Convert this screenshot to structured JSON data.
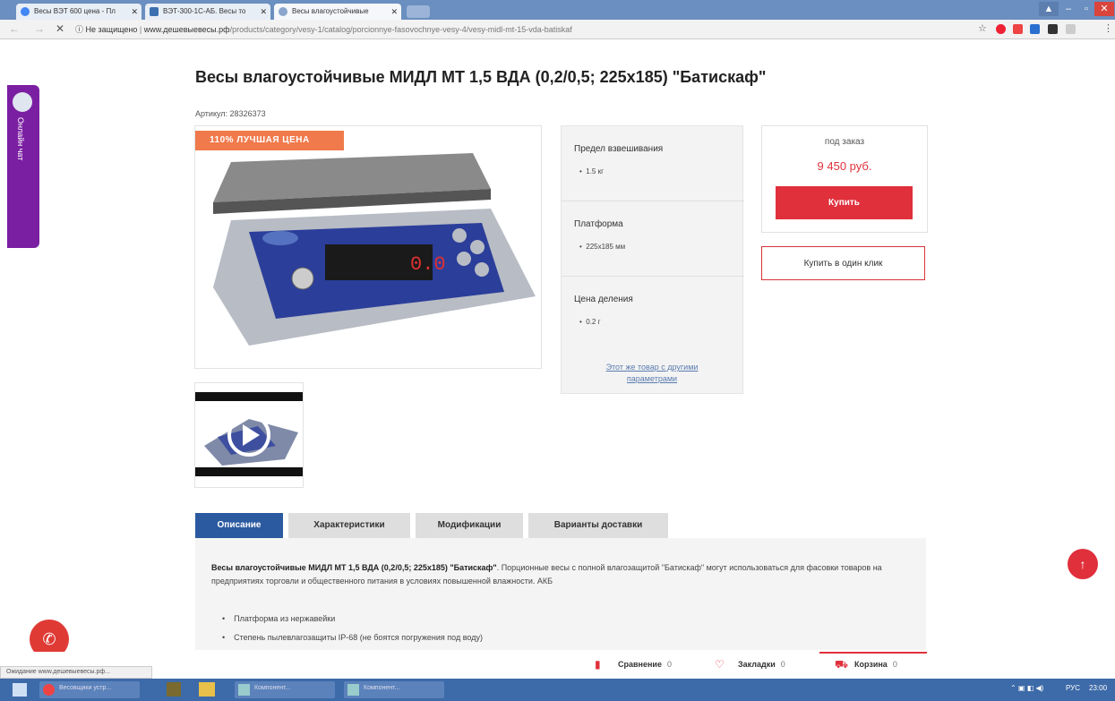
{
  "browser": {
    "tabs": [
      {
        "label": "Весы ВЭТ 600 цена - Пл",
        "color": "#4285f4"
      },
      {
        "label": "ВЭТ-300-1С-АБ. Весы то",
        "color": "#3a6fb0"
      },
      {
        "label": "Весы влагоустойчивые",
        "color": "#8aa6cc"
      }
    ],
    "security_label": "Не защищено",
    "url_host": "www.дешевыевесы.рф",
    "url_path": "/products/category/vesy-1/catalog/porcionnye-fasovochnye-vesy-4/vesy-midl-mt-15-vda-batiskaf",
    "status_text": "Ожидание www.дешевыевесы.рф..."
  },
  "side_chat": {
    "label": "Онлайн чат"
  },
  "product": {
    "title": "Весы влагоустойчивые МИДЛ МТ 1,5 ВДА (0,2/0,5; 225х185) \"Батискаф\"",
    "sku": "Артикул: 28326373",
    "badge": "110% ЛУЧШАЯ ЦЕНА",
    "scale_display": "0.0",
    "specs": [
      {
        "title": "Предел взвешивания",
        "value": "1.5 кг"
      },
      {
        "title": "Платформа",
        "value": "225х185 мм"
      },
      {
        "title": "Цена деления",
        "value": "0.2 г"
      }
    ],
    "other_params_link_1": "Этот же товар с другими",
    "other_params_link_2": "параметрами",
    "availability": "под заказ",
    "price": "9 450 руб.",
    "buy_label": "Купить",
    "one_click_label": "Купить в один клик"
  },
  "tabs": [
    {
      "label": "Описание"
    },
    {
      "label": "Характеристики"
    },
    {
      "label": "Модификации"
    },
    {
      "label": "Варианты доставки"
    }
  ],
  "description": {
    "bold": "Весы влагоустойчивые МИДЛ МТ 1,5 ВДА (0,2/0,5; 225х185) \"Батискаф\"",
    "text": ". Порционные весы с полной влагозащитой \"Батискаф\" могут использоваться для фасовки товаров на предприятиях торговли и общественного питания в условиях повышенной влажности. АКБ",
    "bullets": [
      "Платформа из нержавейки",
      "Степень пылевлагозащиты IP-68 (не боятся погружения под воду)"
    ]
  },
  "bottom_bar": {
    "compare": {
      "label": "Сравнение",
      "count": "0"
    },
    "bookmarks": {
      "label": "Закладки",
      "count": "0"
    },
    "cart": {
      "label": "Корзина",
      "count": "0"
    }
  },
  "taskbar": {
    "items": [
      "Весовщики устр...",
      "Компонент...",
      "Компонент..."
    ],
    "lang": "РУС",
    "time": "23:00"
  }
}
